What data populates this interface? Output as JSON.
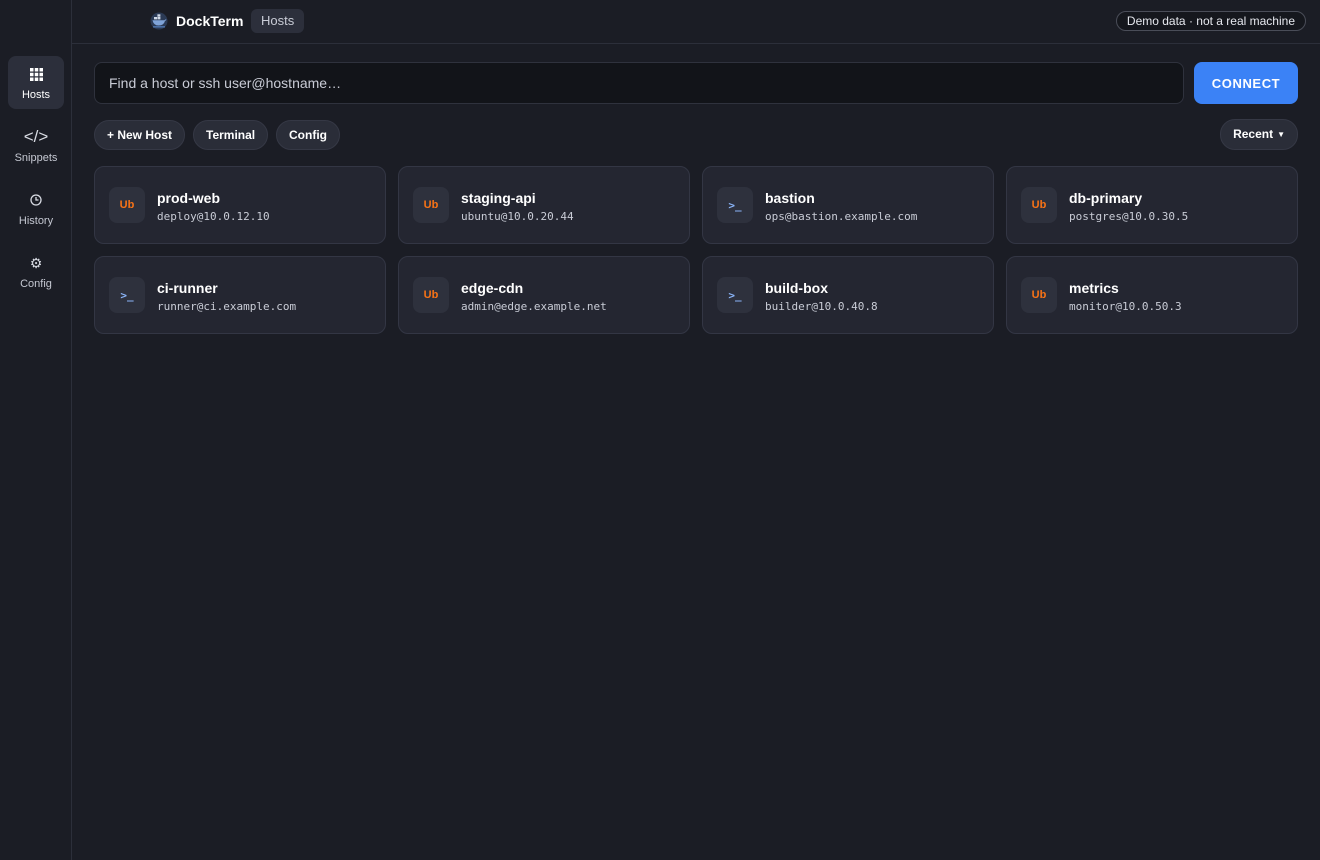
{
  "app": {
    "title": "DockTerm",
    "breadcrumb": "Hosts",
    "badge": "Demo data · not a real machine"
  },
  "sidebar": {
    "items": [
      {
        "label": "Hosts",
        "icon": "grid-icon",
        "active": true
      },
      {
        "label": "Snippets",
        "icon": "code-icon",
        "active": false
      },
      {
        "label": "History",
        "icon": "clock-icon",
        "active": false
      },
      {
        "label": "Config",
        "icon": "gear-icon",
        "active": false
      }
    ]
  },
  "search": {
    "placeholder": "Find a host or ssh user@hostname…",
    "value": ""
  },
  "connect_label": "CONNECT",
  "toolbar": {
    "new_host": "+ New Host",
    "terminal": "Terminal",
    "config": "Config",
    "sort": "Recent"
  },
  "colors": {
    "accent": "#3b82f6",
    "ubuntu": "#f97316",
    "shell": "#8ab4f8"
  },
  "hosts": [
    {
      "name": "prod-web",
      "address": "deploy@10.0.12.10",
      "os": "ubuntu",
      "os_label": "Ub"
    },
    {
      "name": "staging-api",
      "address": "ubuntu@10.0.20.44",
      "os": "ubuntu",
      "os_label": "Ub"
    },
    {
      "name": "bastion",
      "address": "ops@bastion.example.com",
      "os": "shell",
      "os_label": ">_"
    },
    {
      "name": "db-primary",
      "address": "postgres@10.0.30.5",
      "os": "ubuntu",
      "os_label": "Ub"
    },
    {
      "name": "ci-runner",
      "address": "runner@ci.example.com",
      "os": "shell",
      "os_label": ">_"
    },
    {
      "name": "edge-cdn",
      "address": "admin@edge.example.net",
      "os": "ubuntu",
      "os_label": "Ub"
    },
    {
      "name": "build-box",
      "address": "builder@10.0.40.8",
      "os": "shell",
      "os_label": ">_"
    },
    {
      "name": "metrics",
      "address": "monitor@10.0.50.3",
      "os": "ubuntu",
      "os_label": "Ub"
    }
  ]
}
